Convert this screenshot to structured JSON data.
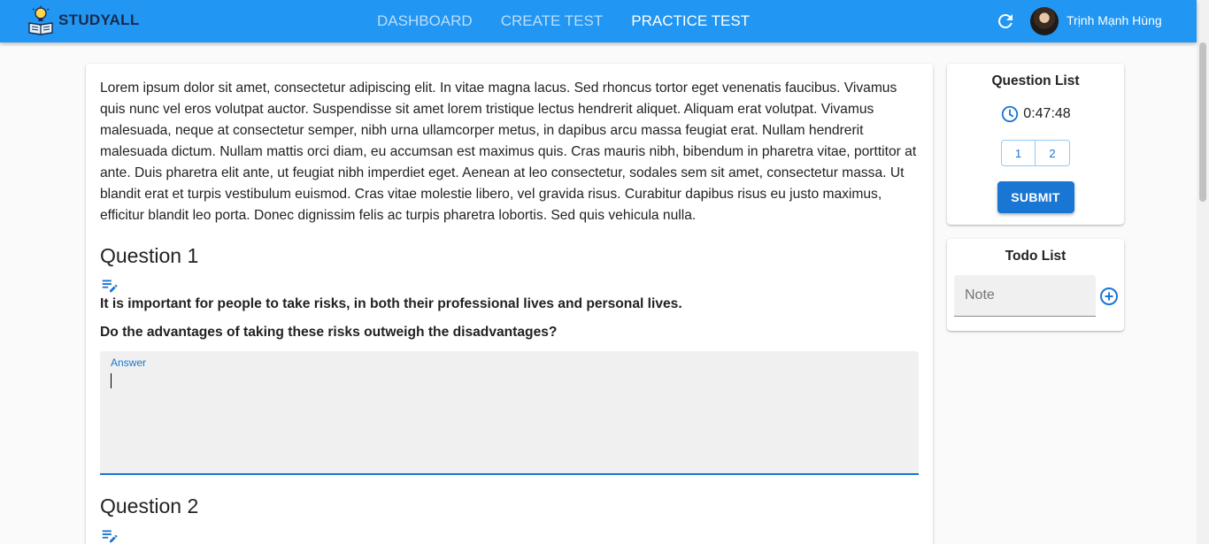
{
  "header": {
    "brand": "STUDYALL",
    "nav": [
      {
        "label": "DASHBOARD"
      },
      {
        "label": "CREATE TEST"
      },
      {
        "label": "PRACTICE TEST"
      }
    ],
    "user_name": "Trịnh Mạnh Hùng",
    "refresh_icon": "refresh-icon",
    "colors": {
      "appbar": "#2196f3",
      "nav_inactive": "#bbdefb",
      "nav_active": "#ffffff"
    }
  },
  "passage": "Lorem ipsum dolor sit amet, consectetur adipiscing elit. In vitae magna lacus. Sed rhoncus tortor eget venenatis faucibus. Vivamus quis nunc vel eros volutpat auctor. Suspendisse sit amet lorem tristique lectus hendrerit aliquet. Aliquam erat volutpat. Vivamus malesuada, neque at consectetur semper, nibh urna ullamcorper metus, in dapibus arcu massa feugiat erat. Nullam hendrerit malesuada dictum. Nullam mattis orci diam, eu accumsan est maximus quis. Cras mauris nibh, bibendum in pharetra vitae, porttitor at ante. Duis pharetra elit ante, ut feugiat nibh imperdiet eget. Aenean at leo consectetur, sodales sem sit amet, consectetur massa. Ut blandit erat et turpis vestibulum euismod. Cras vitae molestie libero, vel gravida risus. Curabitur dapibus risus eu justo maximus, efficitur blandit leo porta. Donec dignissim felis ac turpis pharetra lobortis. Sed quis vehicula nulla.",
  "questions": [
    {
      "title": "Question 1",
      "statement": "It is important for people to take risks, in both their professional lives and personal lives.",
      "prompt": "Do the advantages of taking these risks outweigh the disadvantages?",
      "answer_label": "Answer",
      "answer_value": ""
    },
    {
      "title": "Question 2"
    }
  ],
  "sidebar": {
    "question_list": {
      "title": "Question List",
      "timer": "0:47:48",
      "buttons": [
        "1",
        "2"
      ],
      "submit_label": "SUBMIT"
    },
    "todo_list": {
      "title": "Todo List",
      "note_placeholder": "Note",
      "add_icon": "add-circle-icon"
    }
  }
}
